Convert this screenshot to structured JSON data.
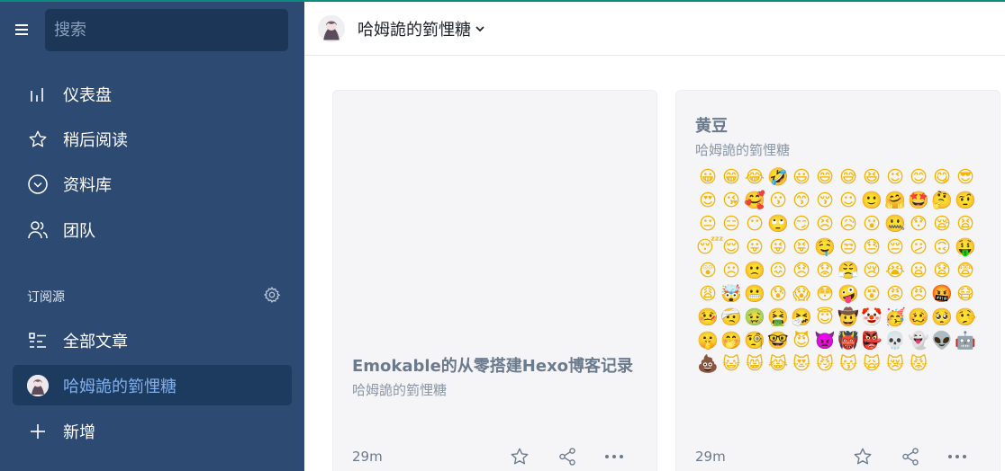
{
  "sidebar": {
    "search_placeholder": "搜索",
    "nav": [
      {
        "label": "仪表盘",
        "icon": "bar-chart-icon"
      },
      {
        "label": "稍后阅读",
        "icon": "star-icon"
      },
      {
        "label": "资料库",
        "icon": "chevron-circle-icon"
      },
      {
        "label": "团队",
        "icon": "users-icon"
      }
    ],
    "section_title": "订阅源",
    "feeds": [
      {
        "label": "全部文章",
        "icon": "list-icon"
      },
      {
        "label": "哈姆詭的箌悝糖",
        "icon": "avatar-icon",
        "active": true
      },
      {
        "label": "新增",
        "icon": "plus-icon"
      }
    ]
  },
  "header": {
    "title": "哈姆詭的箌悝糖"
  },
  "cards": [
    {
      "title": "Emokable的从零搭建Hexo博客记录",
      "source": "哈姆詭的箌悝糖",
      "time": "29m"
    },
    {
      "title": "黄豆",
      "source": "哈姆詭的箌悝糖",
      "time": "29m",
      "emojis": "😀😁😂🤣😃😄😅😆😉😊😋😎😍😘🥰😗😙😚☺🙂🤗🤩🤔🤨😐😑😶🙄😏😣😥😮🤐😯😪😫😴😌😛😜😝🤤😒😓😔😕🙃🤑😲☹🙁😖😞😟😤😢😭😦😧😨😩🤯😬😰😱😳🤪😵😡😠🤬😷🤒🤕🤢🤮🤧😇🤠🤡🥳🥴🥺🤥🤫🤭🧐🤓😈👿👹👺💀👻👽🤖💩😺😸😹😻😼😽🙀😿😾"
    }
  ],
  "colors": {
    "sidebar_bg": "#2c4a72",
    "accent": "#7fb0ee",
    "top_line": "#0f8a7e"
  }
}
